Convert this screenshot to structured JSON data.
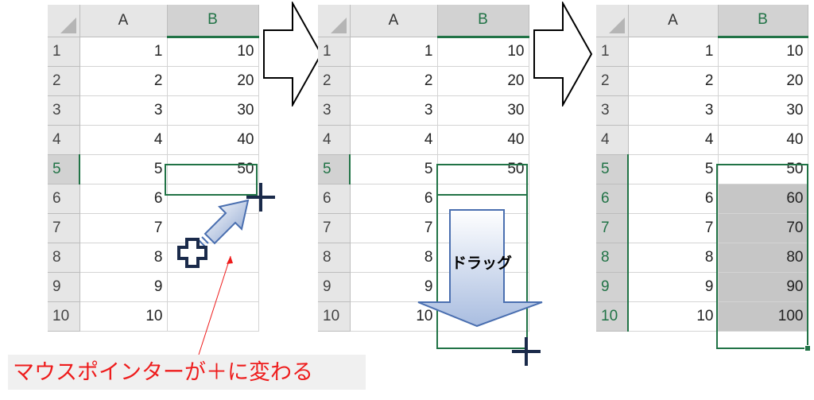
{
  "columns": [
    "A",
    "B"
  ],
  "panel1": {
    "rows": [
      {
        "n": "1",
        "a": "1",
        "b": "10"
      },
      {
        "n": "2",
        "a": "2",
        "b": "20"
      },
      {
        "n": "3",
        "a": "3",
        "b": "30"
      },
      {
        "n": "4",
        "a": "4",
        "b": "40"
      },
      {
        "n": "5",
        "a": "5",
        "b": "50"
      },
      {
        "n": "6",
        "a": "6",
        "b": ""
      },
      {
        "n": "7",
        "a": "7",
        "b": ""
      },
      {
        "n": "8",
        "a": "8",
        "b": ""
      },
      {
        "n": "9",
        "a": "9",
        "b": ""
      },
      {
        "n": "10",
        "a": "10",
        "b": ""
      }
    ]
  },
  "panel2": {
    "rows": [
      {
        "n": "1",
        "a": "1",
        "b": "10"
      },
      {
        "n": "2",
        "a": "2",
        "b": "20"
      },
      {
        "n": "3",
        "a": "3",
        "b": "30"
      },
      {
        "n": "4",
        "a": "4",
        "b": "40"
      },
      {
        "n": "5",
        "a": "5",
        "b": "50"
      },
      {
        "n": "6",
        "a": "6",
        "b": ""
      },
      {
        "n": "7",
        "a": "7",
        "b": ""
      },
      {
        "n": "8",
        "a": "8",
        "b": ""
      },
      {
        "n": "9",
        "a": "9",
        "b": ""
      },
      {
        "n": "10",
        "a": "10",
        "b": ""
      }
    ],
    "drag_label": "ドラッグ"
  },
  "panel3": {
    "rows": [
      {
        "n": "1",
        "a": "1",
        "b": "10"
      },
      {
        "n": "2",
        "a": "2",
        "b": "20"
      },
      {
        "n": "3",
        "a": "3",
        "b": "30"
      },
      {
        "n": "4",
        "a": "4",
        "b": "40"
      },
      {
        "n": "5",
        "a": "5",
        "b": "50"
      },
      {
        "n": "6",
        "a": "6",
        "b": "60"
      },
      {
        "n": "7",
        "a": "7",
        "b": "70"
      },
      {
        "n": "8",
        "a": "8",
        "b": "80"
      },
      {
        "n": "9",
        "a": "9",
        "b": "90"
      },
      {
        "n": "10",
        "a": "10",
        "b": "100"
      }
    ]
  },
  "caption": "マウスポインターが＋に変わる",
  "colors": {
    "excel_green": "#217346",
    "caption_red": "#ee1c1c",
    "arrow_blue": "#4a6fb0"
  }
}
